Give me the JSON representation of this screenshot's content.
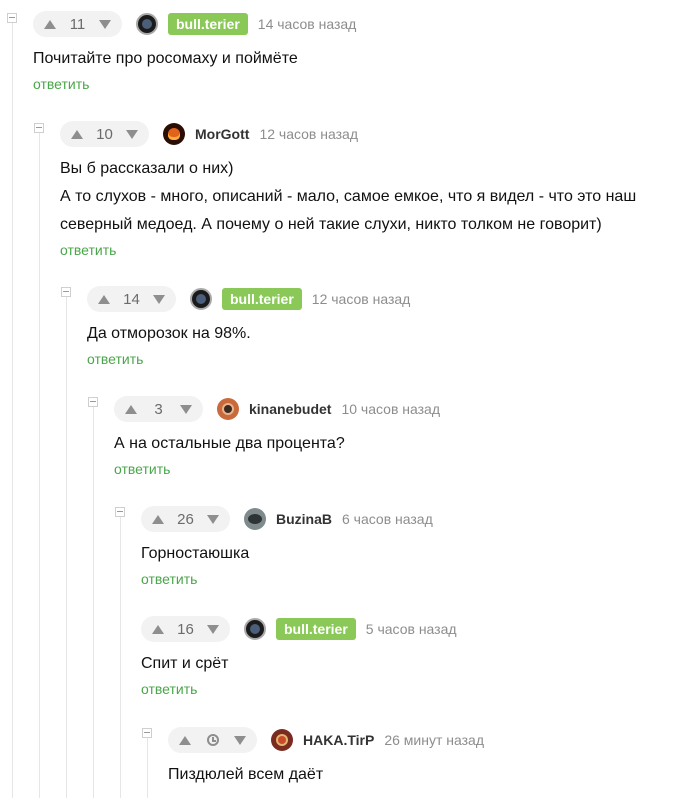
{
  "reply_label": "ответить",
  "colors": {
    "accent_green": "#8ac858",
    "reply_green": "#4aa64a",
    "vote_bg": "#f2f2f2"
  },
  "comments": [
    {
      "votes": "11",
      "author": "bull.terier",
      "author_badge": true,
      "avatar_icon": "bull-terier-avatar-icon",
      "time": "14 часов назад",
      "text": [
        "Почитайте про росомаху и поймёте"
      ]
    },
    {
      "votes": "10",
      "author": "MorGott",
      "author_badge": false,
      "avatar_icon": "morgott-avatar-icon",
      "time": "12 часов назад",
      "text": [
        "Вы б рассказали о них)",
        "А то слухов - много, описаний - мало, самое емкое, что я видел - что это наш",
        "северный медоед. А почему о ней такие слухи, никто толком не говорит)"
      ]
    },
    {
      "votes": "14",
      "author": "bull.terier",
      "author_badge": true,
      "avatar_icon": "bull-terier-avatar-icon",
      "time": "12 часов назад",
      "text": [
        "Да отморозок на 98%."
      ]
    },
    {
      "votes": "3",
      "author": "kinanebudet",
      "author_badge": false,
      "avatar_icon": "kinanebudet-avatar-icon",
      "time": "10 часов назад",
      "text": [
        "А на остальные два процента?"
      ]
    },
    {
      "votes": "26",
      "author": "BuzinaB",
      "author_badge": false,
      "avatar_icon": "buzinab-avatar-icon",
      "time": "6 часов назад",
      "text": [
        "Горностаюшка"
      ]
    },
    {
      "votes": "16",
      "author": "bull.terier",
      "author_badge": true,
      "avatar_icon": "bull-terier-avatar-icon",
      "time": "5 часов назад",
      "text": [
        "Спит и срёт"
      ]
    },
    {
      "votes": "",
      "vote_icon": "clock-icon",
      "author": "HAKA.TirP",
      "author_badge": false,
      "avatar_icon": "haka-tirp-avatar-icon",
      "time": "26 минут назад",
      "text": [
        "Пиздюлей всем даёт"
      ]
    }
  ]
}
